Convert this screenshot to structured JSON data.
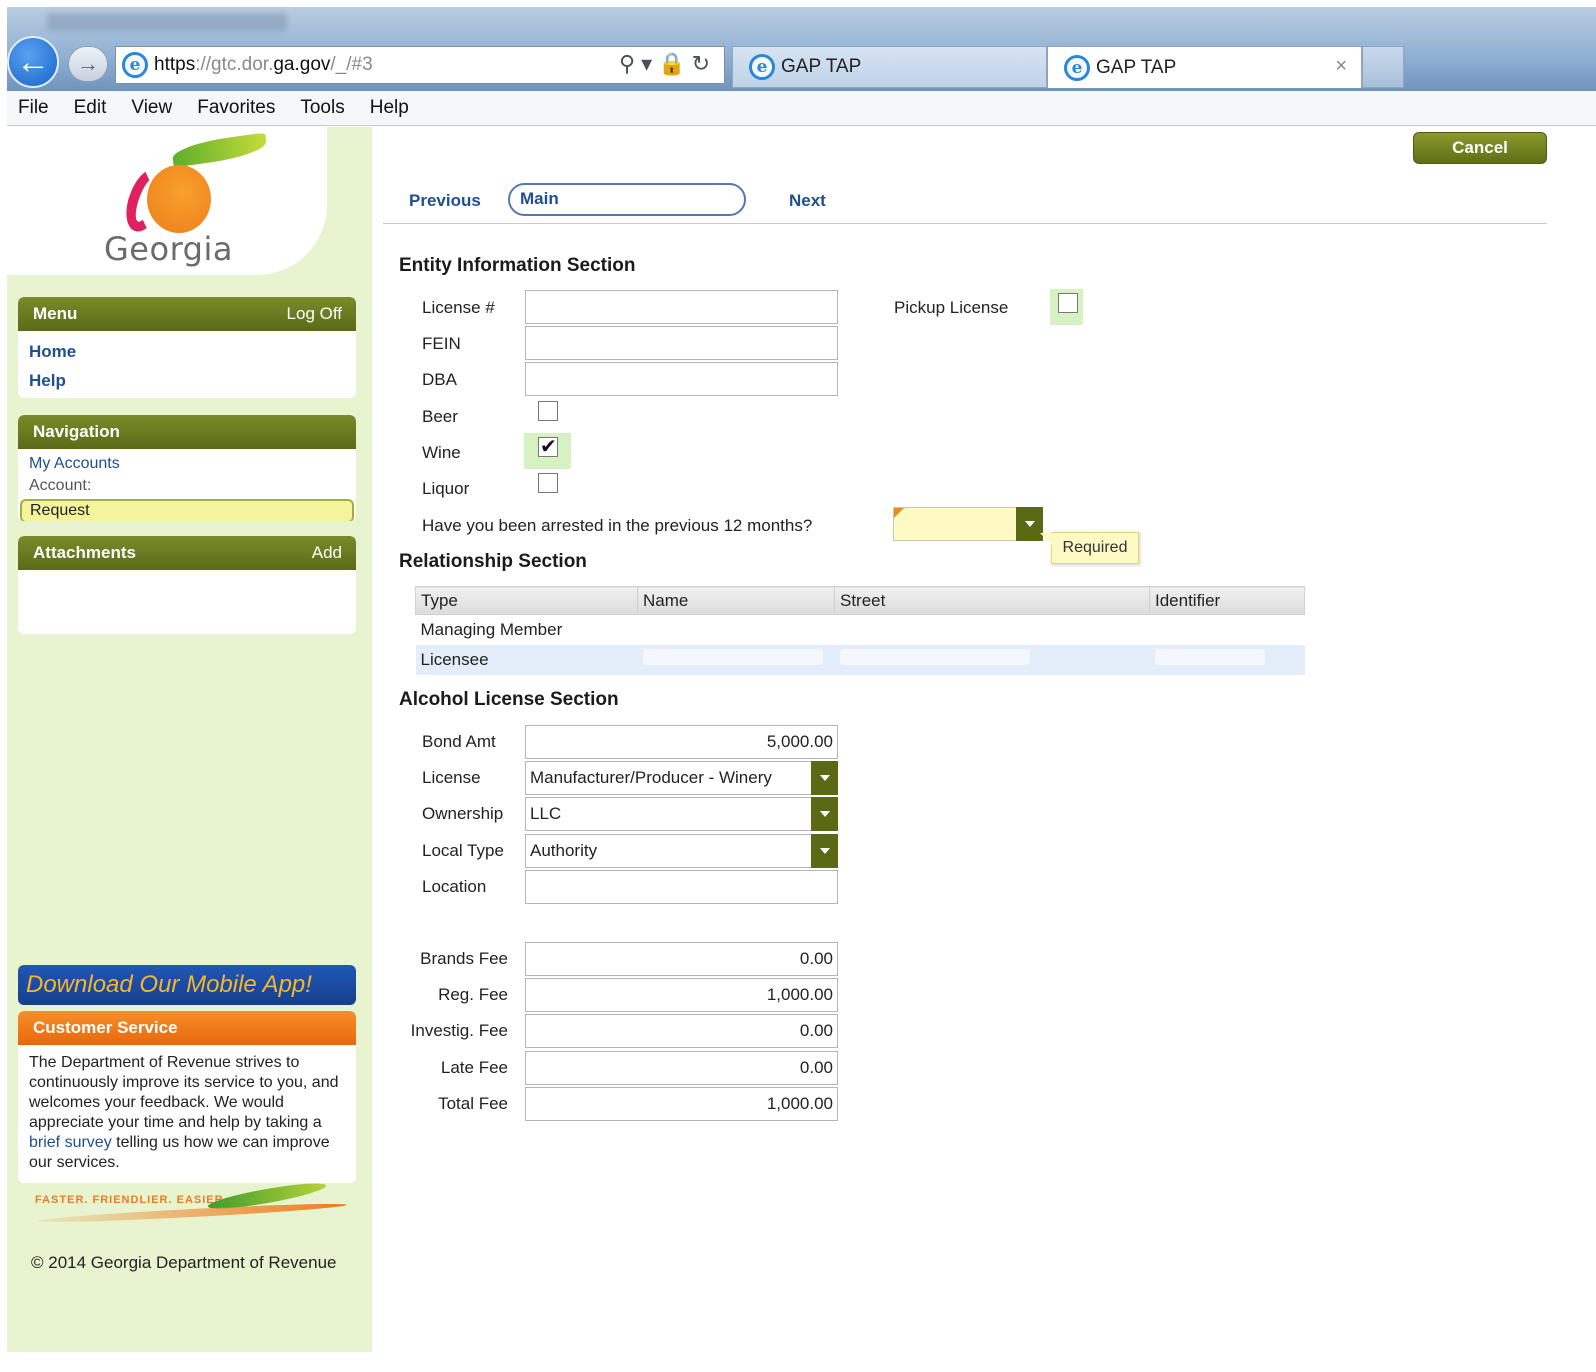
{
  "browser": {
    "url_scheme": "https",
    "url_rest": "://gtc.dor.",
    "url_domain": "ga.gov",
    "url_path": "/_/#3",
    "tabs": [
      {
        "title": "GAP TAP"
      },
      {
        "title": "GAP TAP"
      }
    ],
    "tab_close": "×",
    "menu": [
      "File",
      "Edit",
      "View",
      "Favorites",
      "Tools",
      "Help"
    ]
  },
  "logo": {
    "text": "Georgia"
  },
  "sidebar": {
    "menu_panel": {
      "title": "Menu",
      "action": "Log Off",
      "items": [
        "Home",
        "Help"
      ]
    },
    "navigation_panel": {
      "title": "Navigation",
      "my_accounts": "My Accounts",
      "account_label": "Account:",
      "request": "Request"
    },
    "attachments_panel": {
      "title": "Attachments",
      "action": "Add"
    },
    "mobile_app": "Download Our Mobile App!",
    "customer_service": {
      "title": "Customer Service",
      "text_1": "The Department of Revenue strives to continuously improve its service to you, and welcomes your feedback. We would appreciate your time and help by taking a ",
      "link": "brief survey",
      "text_2": " telling us how we can improve our services."
    },
    "tagline": "FASTER. FRIENDLIER. EASIER.",
    "copyright": "© 2014 Georgia Department of Revenue"
  },
  "toolbar": {
    "cancel": "Cancel",
    "previous": "Previous",
    "current": "Main",
    "next": "Next"
  },
  "entity": {
    "title": "Entity Information Section",
    "license_label": "License #",
    "license_value": "",
    "fein_label": "FEIN",
    "fein_value": "",
    "dba_label": "DBA",
    "dba_value": "",
    "beer_label": "Beer",
    "beer_checked": false,
    "wine_label": "Wine",
    "wine_checked": true,
    "liquor_label": "Liquor",
    "liquor_checked": false,
    "pickup_label": "Pickup License",
    "pickup_checked": false,
    "arrested_label": "Have you been arrested in the previous 12 months?",
    "arrested_value": "",
    "required_tip": "Required"
  },
  "relationship": {
    "title": "Relationship Section",
    "columns": [
      "Type",
      "Name",
      "Street",
      "Identifier"
    ],
    "rows": [
      {
        "type": "Managing Member"
      },
      {
        "type": "Licensee"
      }
    ]
  },
  "alcohol": {
    "title": "Alcohol License Section",
    "bond_label": "Bond Amt",
    "bond_value": "5,000.00",
    "license_label": "License",
    "license_value": "Manufacturer/Producer - Winery",
    "ownership_label": "Ownership",
    "ownership_value": "LLC",
    "local_type_label": "Local Type",
    "local_type_value": "Authority",
    "location_label": "Location",
    "location_value": ""
  },
  "fees": {
    "brands_label": "Brands Fee",
    "brands_value": "0.00",
    "reg_label": "Reg. Fee",
    "reg_value": "1,000.00",
    "investig_label": "Investig. Fee",
    "investig_value": "0.00",
    "late_label": "Late Fee",
    "late_value": "0.00",
    "total_label": "Total Fee",
    "total_value": "1,000.00"
  },
  "colors": {
    "panel_green": "#5a6a18",
    "sidebar_bg": "#e8f4cf",
    "link_blue": "#1f4f8f",
    "cs_orange": "#e8670e",
    "mobile_blue": "#163f8c",
    "required_yellow": "#fff9c4"
  }
}
